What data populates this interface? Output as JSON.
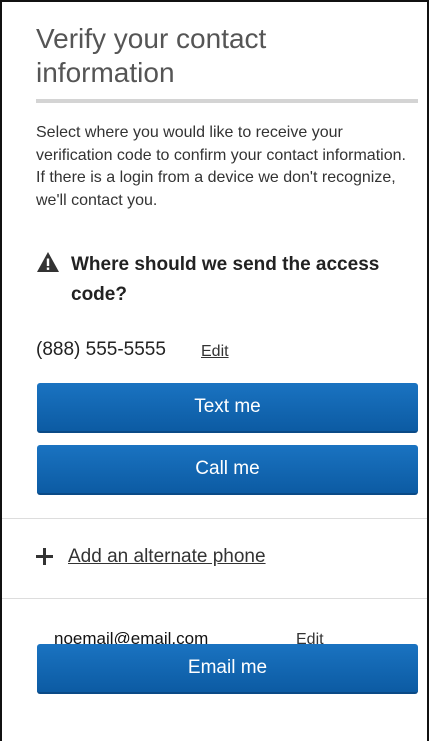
{
  "header": {
    "title": "Verify your contact information"
  },
  "intro": {
    "description": "Select where you would like to receive your verification code to confirm your contact information. If there is a login from a device we don't recognize, we'll contact you."
  },
  "prompt": {
    "icon": "warning-icon",
    "heading": "Where should we send the access code?"
  },
  "phone": {
    "number": "(888) 555-5555",
    "edit_label": "Edit",
    "text_button": "Text me",
    "call_button": "Call me"
  },
  "alternate": {
    "icon": "plus-icon",
    "link_label": "Add an alternate phone"
  },
  "email": {
    "address": "noemail@email.com",
    "edit_label": "Edit",
    "email_button": "Email me"
  },
  "colors": {
    "button_blue": "#0c63ad",
    "text": "#222222",
    "title": "#555555",
    "divider": "#dddddd"
  }
}
